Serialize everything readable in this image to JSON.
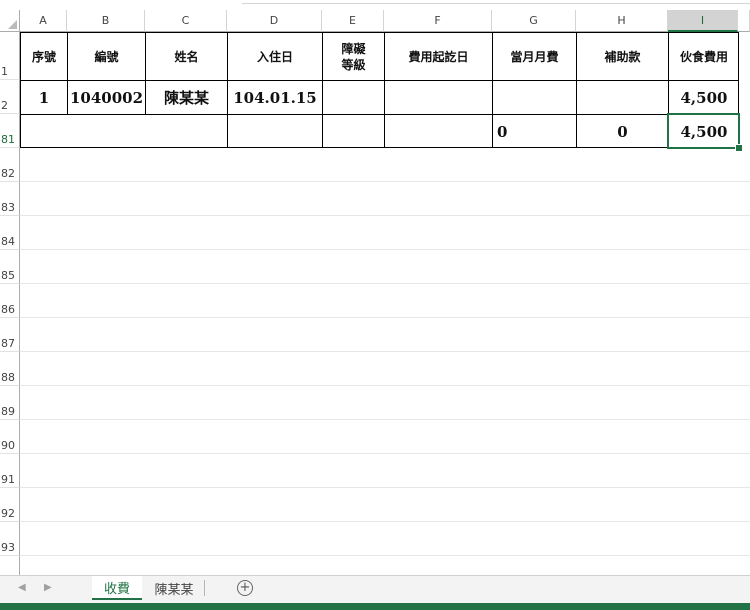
{
  "columns": [
    "A",
    "B",
    "C",
    "D",
    "E",
    "F",
    "G",
    "H",
    "I"
  ],
  "rows": [
    "1",
    "2",
    "81",
    "82",
    "83",
    "84",
    "85",
    "86",
    "87",
    "88",
    "89",
    "90",
    "91",
    "92",
    "93"
  ],
  "header_row": {
    "seq": "序號",
    "code": "編號",
    "name": "姓名",
    "checkin": "入住日",
    "disability_line1": "障礙",
    "disability_line2": "等級",
    "fee_start": "費用起訖日",
    "monthly_fee": "當月月費",
    "subsidy": "補助款",
    "meal_fee": "伙食費用"
  },
  "data_row": {
    "seq": "1",
    "code": "1040002",
    "name": "陳某某",
    "checkin": "104.01.15",
    "disability": "",
    "fee_start": "",
    "monthly_fee": "",
    "subsidy": "",
    "meal_fee": "4,500"
  },
  "total_row": {
    "monthly_fee": "0",
    "subsidy": "0",
    "meal_fee": "4,500"
  },
  "sheet_tabs": [
    "收費",
    "陳某某"
  ],
  "add_sheet_symbol": "+",
  "nav_left": "◀",
  "nav_right": "▶",
  "accent_color": "#217346"
}
